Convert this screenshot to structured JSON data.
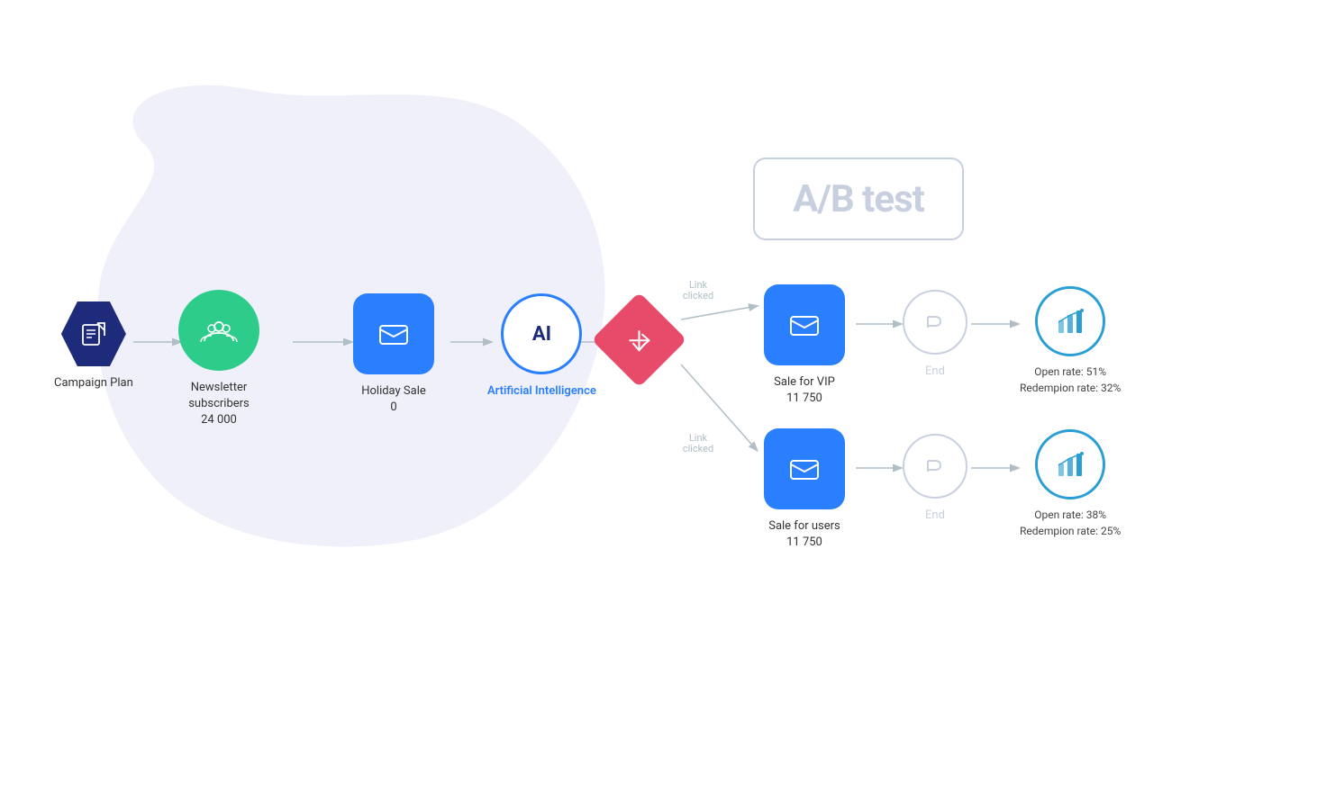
{
  "ab_test": {
    "label": "A/B test"
  },
  "nodes": {
    "campaign_plan": {
      "label": "Campaign Plan"
    },
    "newsletter": {
      "line1": "Newsletter",
      "line2": "subscribers",
      "count": "24 000"
    },
    "holiday_sale": {
      "label": "Holiday Sale",
      "count": "0"
    },
    "ai": {
      "label": "AI",
      "sublabel": "Artificial Intelligence"
    },
    "link_clicked_top": {
      "label": "Link\nclicked"
    },
    "link_clicked_bottom": {
      "label": "Link\nclicked"
    },
    "sale_vip": {
      "label": "Sale for VIP",
      "count": "11 750"
    },
    "sale_users": {
      "label": "Sale for users",
      "count": "11 750"
    },
    "end_top": {
      "label": "End"
    },
    "end_bottom": {
      "label": "End"
    },
    "stats_top": {
      "line1": "Open rate: 51%",
      "line2": "Redempion rate: 32%"
    },
    "stats_bottom": {
      "line1": "Open rate: 38%",
      "line2": "Redempion rate: 25%"
    }
  },
  "colors": {
    "hex_bg": "#1e2a7a",
    "circle_bg": "#2ecc8a",
    "square_bg": "#2a7fff",
    "diamond_bg": "#e84b6a",
    "ghost": "#c8d0e0",
    "stats_border": "#2a9fd6"
  }
}
